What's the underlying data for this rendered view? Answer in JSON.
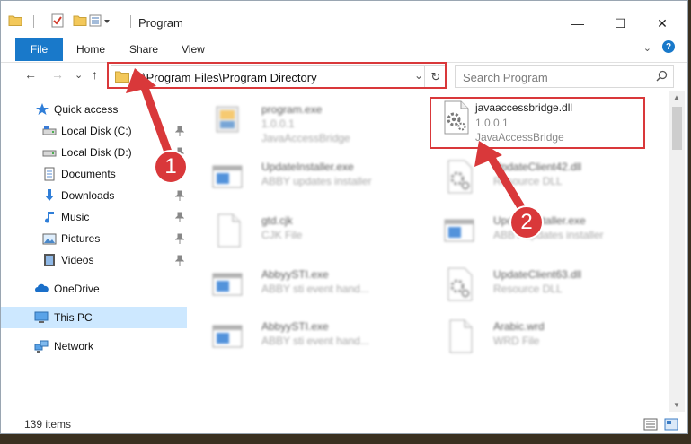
{
  "window": {
    "title": "Program",
    "minimize_symbol": "—",
    "maximize_symbol": "☐",
    "close_symbol": "✕"
  },
  "ribbon": {
    "file_label": "File",
    "tabs": [
      "Home",
      "Share",
      "View"
    ],
    "expand_symbol": "⌄",
    "help_symbol": "?"
  },
  "nav": {
    "back_symbol": "←",
    "forward_symbol": "→",
    "recent_symbol": "⌄",
    "up_symbol": "↑"
  },
  "address": {
    "path": "C:\\Program Files\\Program Directory",
    "dropdown_symbol": "⌄",
    "refresh_symbol": "↻"
  },
  "search": {
    "placeholder": "Search Program"
  },
  "sidebar": {
    "items": [
      {
        "label": "Quick access",
        "icon": "star-icon",
        "pinned": false
      },
      {
        "label": "Local Disk (C:)",
        "icon": "drive-icon",
        "pinned": true
      },
      {
        "label": "Local Disk (D:)",
        "icon": "drive-icon",
        "pinned": true
      },
      {
        "label": "Documents",
        "icon": "documents-icon",
        "pinned": true
      },
      {
        "label": "Downloads",
        "icon": "download-icon",
        "pinned": true
      },
      {
        "label": "Music",
        "icon": "music-icon",
        "pinned": true
      },
      {
        "label": "Pictures",
        "icon": "pictures-icon",
        "pinned": true
      },
      {
        "label": "Videos",
        "icon": "videos-icon",
        "pinned": true
      },
      {
        "label": "OneDrive",
        "icon": "cloud-icon",
        "pinned": false
      },
      {
        "label": "This PC",
        "icon": "computer-icon",
        "pinned": false
      },
      {
        "label": "Network",
        "icon": "network-icon",
        "pinned": false
      }
    ]
  },
  "files": [
    {
      "name": "program.exe",
      "line2": "1.0.0.1",
      "line3": "JavaAccessBridge",
      "icon": "installer-icon"
    },
    {
      "name": "javaaccessbridge.dll",
      "line2": "1.0.0.1",
      "line3": "JavaAccessBridge",
      "icon": "dll-gear-icon"
    },
    {
      "name": "UpdateInstaller.exe",
      "line2": "ABBY updates installer",
      "line3": "",
      "icon": "window-app-icon"
    },
    {
      "name": "UpdateClient42.dll",
      "line2": "Resource DLL",
      "line3": "",
      "icon": "dll-gear-icon"
    },
    {
      "name": "gtd.cjk",
      "line2": "CJK File",
      "line3": "",
      "icon": "blank-file-icon"
    },
    {
      "name": "UpdateInstaller.exe",
      "line2": "ABBY updates installer",
      "line3": "",
      "icon": "window-app-icon"
    },
    {
      "name": "AbbyySTI.exe",
      "line2": "ABBY sti event hand...",
      "line3": "",
      "icon": "window-app-icon"
    },
    {
      "name": "UpdateClient63.dll",
      "line2": "Resource DLL",
      "line3": "",
      "icon": "dll-gear-icon"
    },
    {
      "name": "AbbyySTI.exe",
      "line2": "ABBY sti event hand...",
      "line3": "",
      "icon": "window-app-icon"
    },
    {
      "name": "Arabic.wrd",
      "line2": "WRD File",
      "line3": "",
      "icon": "blank-file-icon"
    }
  ],
  "status": {
    "item_count": "139 items"
  },
  "annotations": [
    {
      "number": "1",
      "target": "address-bar"
    },
    {
      "number": "2",
      "target": "javaaccessbridge.dll"
    }
  ],
  "colors": {
    "accent": "#1979ca",
    "selection": "#cde8ff",
    "annotation": "#d9383a"
  }
}
